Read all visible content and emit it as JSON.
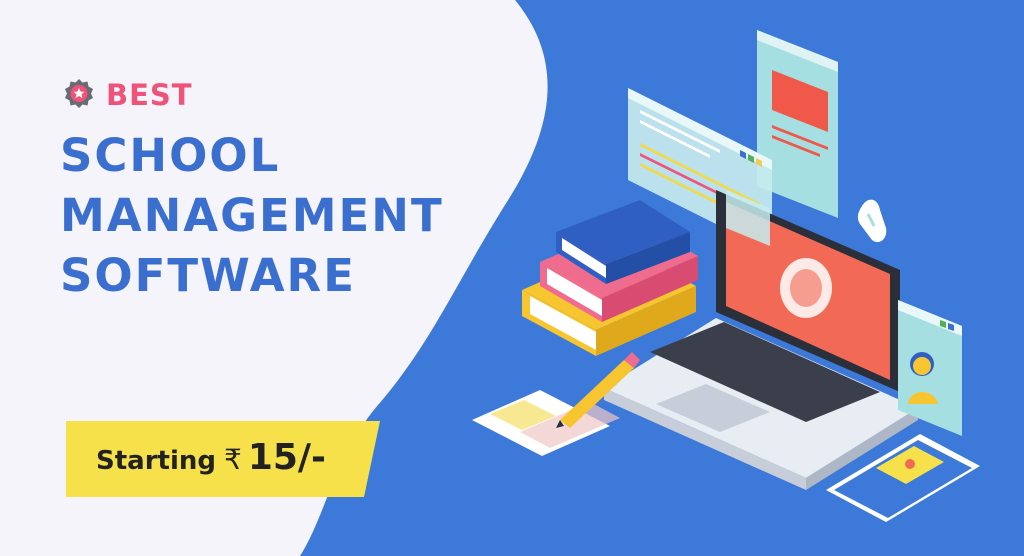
{
  "badge": {
    "icon": "star-badge-icon",
    "label": "BEST"
  },
  "headline": {
    "line1": "SCHOOL",
    "line2": "MANAGEMENT",
    "line3": "SOFTWARE"
  },
  "price": {
    "prefix": "Starting",
    "currency": "₹",
    "amount": "15/-"
  },
  "colors": {
    "background_left": "#f4f4fa",
    "background_right": "#3d79d9",
    "headline": "#3b6fcf",
    "badge_text": "#f0537a",
    "price_box": "#f6e14a"
  }
}
